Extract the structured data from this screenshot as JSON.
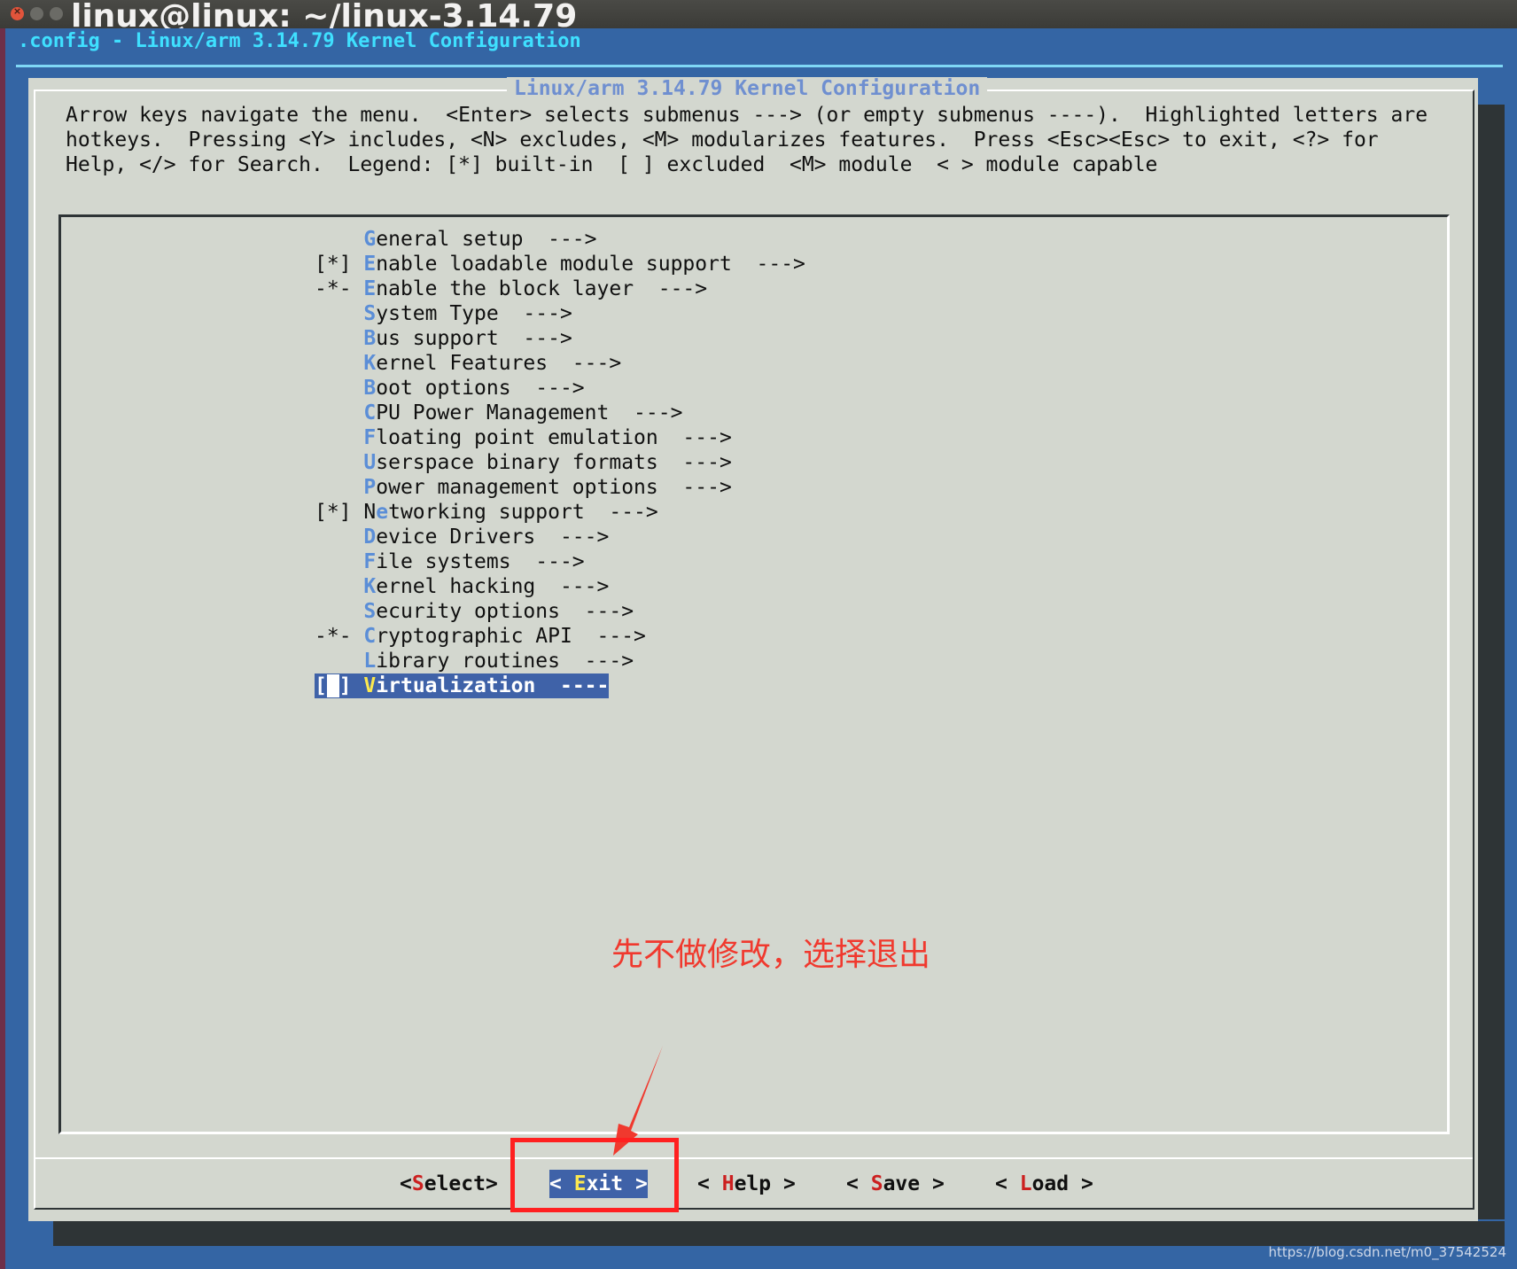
{
  "window": {
    "title": "linux@linux: ~/linux-3.14.79"
  },
  "terminal": {
    "title": ".config - Linux/arm 3.14.79 Kernel Configuration"
  },
  "dialog": {
    "title": "Linux/arm 3.14.79 Kernel Configuration",
    "help_text": "Arrow keys navigate the menu.  <Enter> selects submenus ---> (or empty submenus ----).  Highlighted letters are\nhotkeys.  Pressing <Y> includes, <N> excludes, <M> modularizes features.  Press <Esc><Esc> to exit, <?> for\nHelp, </> for Search.  Legend: [*] built-in  [ ] excluded  <M> module  < > module capable"
  },
  "menu": [
    {
      "prefix": "    ",
      "hotkey": "G",
      "rest": "eneral setup  --->"
    },
    {
      "prefix": "[*] ",
      "hotkey": "E",
      "rest": "nable loadable module support  --->"
    },
    {
      "prefix": "-*- ",
      "hotkey": "E",
      "rest": "nable the block layer  --->"
    },
    {
      "prefix": "    ",
      "hotkey": "S",
      "rest": "ystem Type  --->"
    },
    {
      "prefix": "    ",
      "hotkey": "B",
      "rest": "us support  --->"
    },
    {
      "prefix": "    ",
      "hotkey": "K",
      "rest": "ernel Features  --->"
    },
    {
      "prefix": "    ",
      "hotkey": "B",
      "rest": "oot options  --->"
    },
    {
      "prefix": "    ",
      "hotkey": "C",
      "rest": "PU Power Management  --->"
    },
    {
      "prefix": "    ",
      "hotkey": "F",
      "rest": "loating point emulation  --->"
    },
    {
      "prefix": "    ",
      "hotkey": "U",
      "rest": "serspace binary formats  --->"
    },
    {
      "prefix": "    ",
      "hotkey": "P",
      "rest": "ower management options  --->"
    },
    {
      "prefix": "[*] N",
      "hotkey": "e",
      "rest": "tworking support  --->"
    },
    {
      "prefix": "    ",
      "hotkey": "D",
      "rest": "evice Drivers  --->"
    },
    {
      "prefix": "    ",
      "hotkey": "F",
      "rest": "ile systems  --->"
    },
    {
      "prefix": "    ",
      "hotkey": "K",
      "rest": "ernel hacking  --->"
    },
    {
      "prefix": "    ",
      "hotkey": "S",
      "rest": "ecurity options  --->"
    },
    {
      "prefix": "-*- ",
      "hotkey": "C",
      "rest": "ryptographic API  --->"
    },
    {
      "prefix": "    ",
      "hotkey": "L",
      "rest": "ibrary routines  --->"
    }
  ],
  "selected_item": {
    "open": "[",
    "cursor": " ",
    "close": "] ",
    "hotkey": "V",
    "rest": "irtualization  ----"
  },
  "buttons": {
    "select": {
      "pre": "<",
      "key": "S",
      "post": "elect>"
    },
    "exit": {
      "pre": "< ",
      "key": "E",
      "post": "xit >"
    },
    "help": {
      "pre": "< ",
      "key": "H",
      "post": "elp >"
    },
    "save": {
      "pre": "< ",
      "key": "S",
      "post": "ave >"
    },
    "load": {
      "pre": "< ",
      "key": "L",
      "post": "oad >"
    }
  },
  "annotation": "先不做修改，选择退出",
  "watermark": "https://blog.csdn.net/m0_37542524",
  "colors": {
    "terminal_bg": "#3465a4",
    "dialog_bg": "#d3d7cf",
    "hotkey": "#5b8ed7",
    "selection_bg": "#3f62a8",
    "annotation_red": "#f0392e"
  }
}
